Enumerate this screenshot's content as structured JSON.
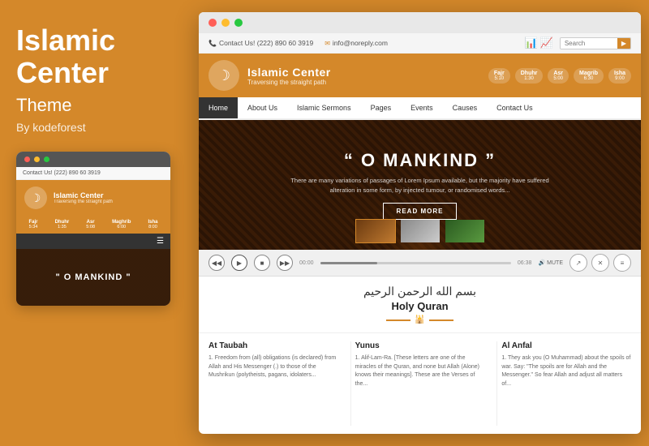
{
  "left": {
    "title": "Islamic\nCenter",
    "subtitle": "Theme",
    "by": "By kodeforest",
    "phone_mockup": {
      "contact": "Contact Us! (222) 890 60 3919",
      "site_name": "Islamic Center",
      "tagline": "Traversing the straight path",
      "prayer_times": [
        {
          "name": "Fajr",
          "time": "5:34"
        },
        {
          "name": "Dhuhr",
          "time": "1:35"
        },
        {
          "name": "Asr",
          "time": "5:08"
        },
        {
          "name": "Maghrib",
          "time": "6:00"
        },
        {
          "name": "Isha",
          "time": "8:00"
        }
      ],
      "hero_text": "\" O MANKIND \""
    }
  },
  "browser": {
    "topbar": {
      "contact_phone": "Contact Us! (222) 890 60 3919",
      "email": "info@noreply.com",
      "search_placeholder": "Search"
    },
    "header": {
      "site_name": "Islamic Center",
      "tagline": "Traversing the straight path",
      "prayer_times": [
        {
          "name": "Fajr",
          "time": "5:10"
        },
        {
          "name": "Dhuhr",
          "time": "1:30"
        },
        {
          "name": "Asr",
          "time": "5:00"
        },
        {
          "name": "Maghrib",
          "time": "6:30"
        },
        {
          "name": "Isha",
          "time": "9:00"
        }
      ]
    },
    "nav": {
      "items": [
        "Home",
        "About Us",
        "Islamic Sermons",
        "Pages",
        "Events",
        "Causes",
        "Contact Us"
      ],
      "active": "Home"
    },
    "hero": {
      "quote_open": "“ O MANKIND ”",
      "description": "There are many variations of passages of Lorem Ipsum available, but the majority have suffered alteration in some form, by injected tumour, or randomised words...",
      "read_more": "READ MORE"
    },
    "audio": {
      "time_start": "00:00",
      "time_end": "06:38",
      "mute_label": "MUTE"
    },
    "quran": {
      "arabic_text": "بسم الله الرحمن الرحيم",
      "title": "Holy Quran"
    },
    "columns": [
      {
        "title": "At Taubah",
        "text": "1. Freedom from (all) obligations (is declared) from Allah and His Messenger (.) to those of the Mushrikun (polytheists, pagans, idolaters..."
      },
      {
        "title": "Yunus",
        "text": "1. Alif-Lam-Ra. [These letters are one of the miracles of the Quran, and none but Allah (Alone) knows their meanings]. These are the Verses of the..."
      },
      {
        "title": "Al Anfal",
        "text": "1. They ask you (O Muhammad) about the spoils of war. Say: \"The spoils are for Allah and the Messenger.\" So fear Allah and adjust all matters of..."
      }
    ]
  },
  "colors": {
    "orange": "#D4882A",
    "dark": "#333333",
    "white": "#ffffff"
  }
}
